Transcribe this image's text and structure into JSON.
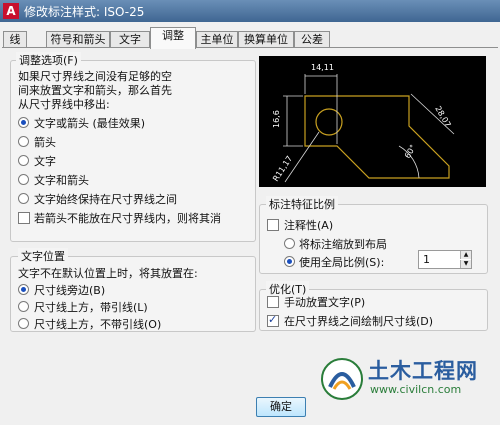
{
  "window": {
    "title": "修改标注样式: ISO-25",
    "app_icon": "A"
  },
  "tabs": [
    "线",
    "符号和箭头",
    "文字",
    "调整",
    "主单位",
    "换算单位",
    "公差"
  ],
  "active_tab": "调整",
  "fit": {
    "title": "调整选项(F)",
    "description": [
      "如果尺寸界线之间没有足够的空",
      "间来放置文字和箭头，那么首先",
      "从尺寸界线中移出:"
    ],
    "options": [
      "文字或箭头 (最佳效果)",
      "箭头",
      "文字",
      "文字和箭头",
      "文字始终保持在尺寸界线之间"
    ],
    "selected": 0,
    "suppress_label": "若箭头不能放在尺寸界线内，则将其消",
    "suppress_checked": false
  },
  "text_placement": {
    "title": "文字位置",
    "description": "文字不在默认位置上时，将其放置在:",
    "options": [
      "尺寸线旁边(B)",
      "尺寸线上方，带引线(L)",
      "尺寸线上方，不带引线(O)"
    ],
    "selected": 0
  },
  "preview": {
    "dims": [
      "14,11",
      "16,6",
      "28,07",
      "R11,17",
      "60°"
    ]
  },
  "scale": {
    "title": "标注特征比例",
    "annotative_label": "注释性(A)",
    "annotative_checked": false,
    "options": [
      "将标注缩放到布局",
      "使用全局比例(S):"
    ],
    "selected": 1,
    "value": "1"
  },
  "fine_tuning": {
    "title": "优化(T)",
    "items": [
      {
        "label": "手动放置文字(P)",
        "checked": false
      },
      {
        "label": "在尺寸界线之间绘制尺寸线(D)",
        "checked": true
      }
    ]
  },
  "buttons": {
    "ok": "确定"
  },
  "watermark": {
    "name": "土木工程网",
    "url": "www.civilcn.com"
  }
}
